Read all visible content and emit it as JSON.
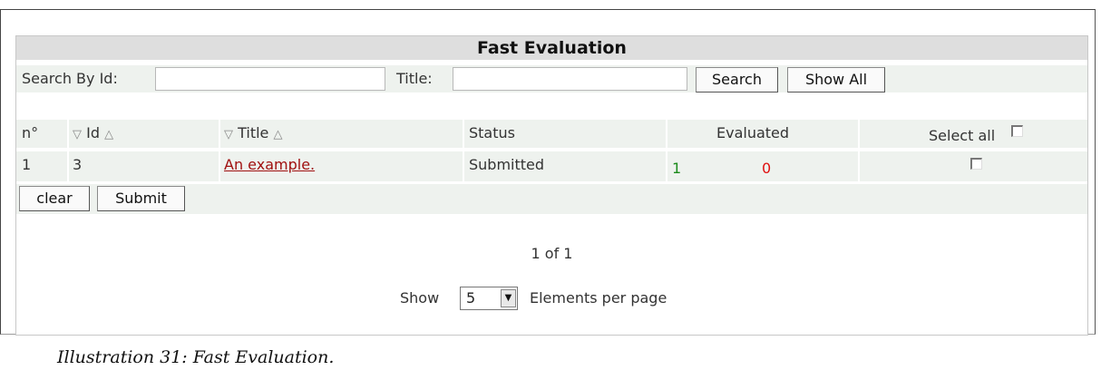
{
  "panel": {
    "title": "Fast Evaluation"
  },
  "search": {
    "id_label": "Search By Id:",
    "id_value": "",
    "title_label": "Title:",
    "title_value": "",
    "search_button": "Search",
    "show_all_button": "Show All"
  },
  "table": {
    "columns": {
      "number": "n°",
      "id": "Id",
      "title": "Title",
      "status": "Status",
      "evaluated": "Evaluated",
      "select_all": "Select all"
    },
    "rows": [
      {
        "number": "1",
        "id": "3",
        "title": "An example.",
        "status": "Submitted",
        "evaluated_yes": "1",
        "evaluated_no": "0",
        "selected": false
      }
    ]
  },
  "actions": {
    "clear": "clear",
    "submit": "Submit"
  },
  "pager": {
    "position": "1 of 1",
    "show_label": "Show",
    "per_page_value": "5",
    "per_page_suffix": "Elements per page"
  },
  "caption": "Illustration 31: Fast Evaluation.",
  "colors": {
    "link": "#a01010",
    "yes": "#1a8a1a",
    "no": "#e01010",
    "row_bg": "#eef2ee",
    "title_bg": "#dedede"
  },
  "icons": {
    "sort_up": "filter-funnel-icon",
    "sort_down": "triangle-sort-icon"
  }
}
